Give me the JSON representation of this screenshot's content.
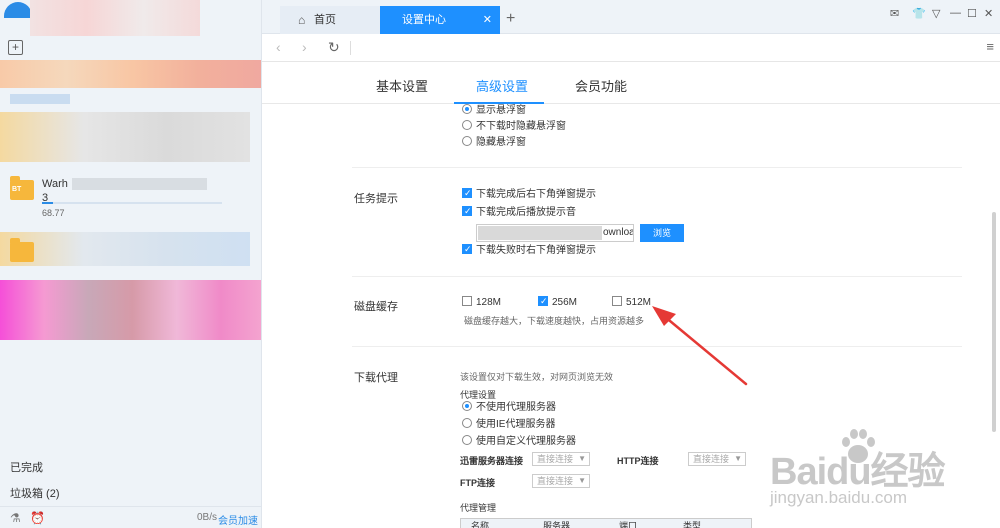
{
  "sidebar": {
    "task1": {
      "name": "Warh",
      "name2": "3",
      "size": "68.77"
    },
    "completed_label": "已完成",
    "trash_label": "垃圾箱 (2)",
    "speed": "0B/s",
    "accelerate_label": "会员加速"
  },
  "tabs": {
    "home_label": "首页",
    "settings_label": "设置中心",
    "close_glyph": "✕",
    "plus_glyph": "+"
  },
  "window_controls": [
    "✉",
    "👕",
    "▽",
    "—",
    "☐",
    "✕"
  ],
  "settings_tabs": [
    "基本设置",
    "高级设置",
    "会员功能"
  ],
  "active_settings_tab": "高级设置",
  "float_window": {
    "options": [
      "显示悬浮窗",
      "不下载时隐藏悬浮窗",
      "隐藏悬浮窗"
    ],
    "selected": "显示悬浮窗"
  },
  "task_prompt": {
    "label": "任务提示",
    "opt1": "下载完成后右下角弹窗提示",
    "opt2": "下载完成后播放提示音",
    "path_text": "ownloa",
    "browse_label": "浏览",
    "opt3": "下载失败时右下角弹窗提示"
  },
  "disk_cache": {
    "label": "磁盘缓存",
    "options": [
      "128M",
      "256M",
      "512M"
    ],
    "selected": "256M",
    "hint": "磁盘缓存越大，下载速度越快，占用资源越多"
  },
  "proxy": {
    "label": "下载代理",
    "hint": "该设置仅对下载生效，对网页浏览无效",
    "settings_label": "代理设置",
    "options": [
      "不使用代理服务器",
      "使用IE代理服务器",
      "使用自定义代理服务器"
    ],
    "selected": "不使用代理服务器",
    "xunlei_label": "迅雷服务器连接",
    "http_label": "HTTP连接",
    "ftp_label": "FTP连接",
    "dropdown_value": "直接连接",
    "manage_label": "代理管理",
    "table_headers": [
      "名称",
      "服务器",
      "端口",
      "类型"
    ]
  },
  "watermark": {
    "brand": "Baidu经验",
    "url": "jingyan.baidu.com"
  },
  "colors": {
    "accent": "#1e90ff",
    "arrow": "#e53935"
  }
}
